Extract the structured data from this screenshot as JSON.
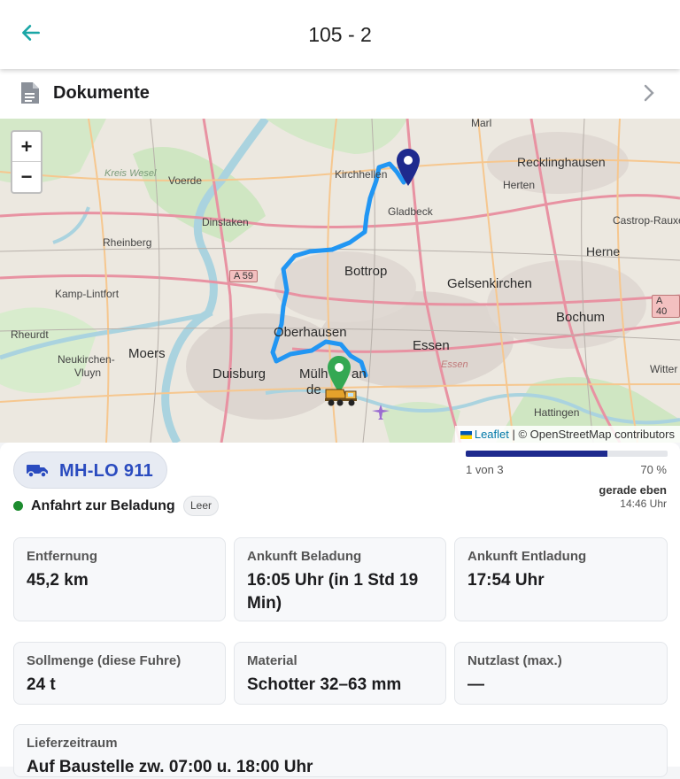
{
  "header": {
    "title": "105 - 2"
  },
  "documents": {
    "label": "Dokumente"
  },
  "map": {
    "zoom_in": "+",
    "zoom_out": "−",
    "attribution_link": "Leaflet",
    "attribution_text": " | © OpenStreetMap contributors",
    "labels": {
      "recklinghausen": "Recklinghausen",
      "marl": "Marl",
      "herten": "Herten",
      "castrop": "Castrop-Rauxel",
      "kreis_wesel": "Kreis Wesel",
      "voerde": "Voerde",
      "kirchhellen": "Kirchhellen",
      "gladbeck": "Gladbeck",
      "dinslaken": "Dinslaken",
      "rheinberg": "Rheinberg",
      "herne": "Herne",
      "bottrop": "Bottrop",
      "gelsenkirchen": "Gelsenkirchen",
      "kamp_lintfort": "Kamp-Lintfort",
      "a59": "A 59",
      "a40": "A 40",
      "bochum": "Bochum",
      "rheurdt": "Rheurdt",
      "oberhausen": "Oberhausen",
      "essen": "Essen",
      "essen_small": "Essen",
      "moers": "Moers",
      "neukirchen": "Neukirchen-",
      "vluyn": "Vluyn",
      "duisburg": "Duisburg",
      "mulheim1": "Mülh",
      "mulheim2": "an",
      "mulheim3": "de",
      "witten": "Witter",
      "hattingen": "Hattingen"
    },
    "colors": {
      "route": "#2196f3",
      "destination_pin": "#1e2a8e",
      "origin_pin": "#34a853"
    }
  },
  "vehicle": {
    "plate": "MH-LO 911",
    "status": "Anfahrt zur Beladung",
    "load_state": "Leer",
    "status_color": "#1d8c2f"
  },
  "progress": {
    "step_text": "1 von 3",
    "percent_text": "70 %",
    "percent": 70,
    "updated": "gerade eben",
    "time": "14:46 Uhr"
  },
  "cards": {
    "distance": {
      "label": "Entfernung",
      "value": "45,2 km"
    },
    "arrival_loading": {
      "label": "Ankunft Beladung",
      "value": "16:05 Uhr (in 1 Std 19 Min)"
    },
    "arrival_unloading": {
      "label": "Ankunft Entladung",
      "value": "17:54 Uhr"
    },
    "target_amount": {
      "label": "Sollmenge (diese Fuhre)",
      "value": "24 t"
    },
    "material": {
      "label": "Material",
      "value": "Schotter 32–63 mm"
    },
    "payload": {
      "label": "Nutzlast (max.)",
      "value": "—"
    },
    "delivery": {
      "label": "Lieferzeitraum",
      "value": "Auf Baustelle zw. 07:00 u. 18:00 Uhr"
    }
  }
}
